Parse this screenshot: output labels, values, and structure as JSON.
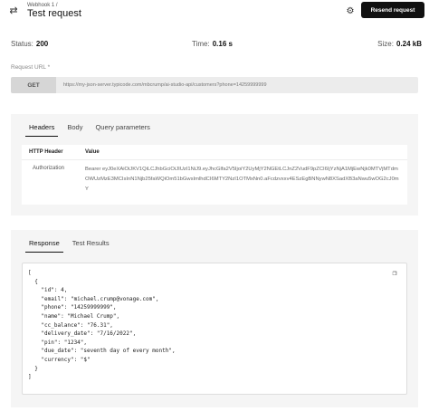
{
  "header": {
    "breadcrumb": "Webhook 1  /",
    "title": "Test request",
    "resend_label": "Resend request",
    "icons": {
      "back": "swap-arrows-icon",
      "settings": "gear-icon"
    }
  },
  "status": {
    "status_label": "Status:",
    "status_value": "200",
    "time_label": "Time:",
    "time_value": "0.16 s",
    "size_label": "Size:",
    "size_value": "0.24 kB"
  },
  "request_url": {
    "label": "Request URL *",
    "method": "GET",
    "url": "https://my-json-server.typicode.com/mbcrump/ai-studio-api/customers?phone=14259999999"
  },
  "request_tabs": [
    "Headers",
    "Body",
    "Query parameters"
  ],
  "headers_table": {
    "col_header": "HTTP Header",
    "col_value": "Value",
    "rows": [
      {
        "key": "Authorization",
        "value": "Bearer eyJ0eXAiOiJKV1QiLCJhbGciOiJIUzI1NiJ9.eyJhcGlfa2V5IjoiY2UyMjY2NGEtLCJnZ2VudF9pZCI6IjYzNjA1MjEwNjk0MTVjMTdmOWUzMzE3MCIsInN1Njb25faWQiOm51bGwsImlhdCI6MTY2NzI1OTMxNn0.aFcdzvxxv4ESzEgBNNywN8XSadXB3aNwu5wOG2cJ0mY"
      }
    ]
  },
  "response_tabs": [
    "Response",
    "Test Results"
  ],
  "response_code": [
    "[",
    "  {",
    "    \"id\": 4,",
    "    \"email\": \"michael.crump@vonage.com\",",
    "    \"phone\": \"14259999999\",",
    "    \"name\": \"Michael Crump\",",
    "    \"cc_balance\": \"76.31\",",
    "    \"delivery_date\": \"7/16/2022\",",
    "    \"pin\": \"1234\",",
    "    \"due_date\": \"seventh day of every month\",",
    "    \"currency\": \"$\"",
    "  }",
    "]"
  ]
}
